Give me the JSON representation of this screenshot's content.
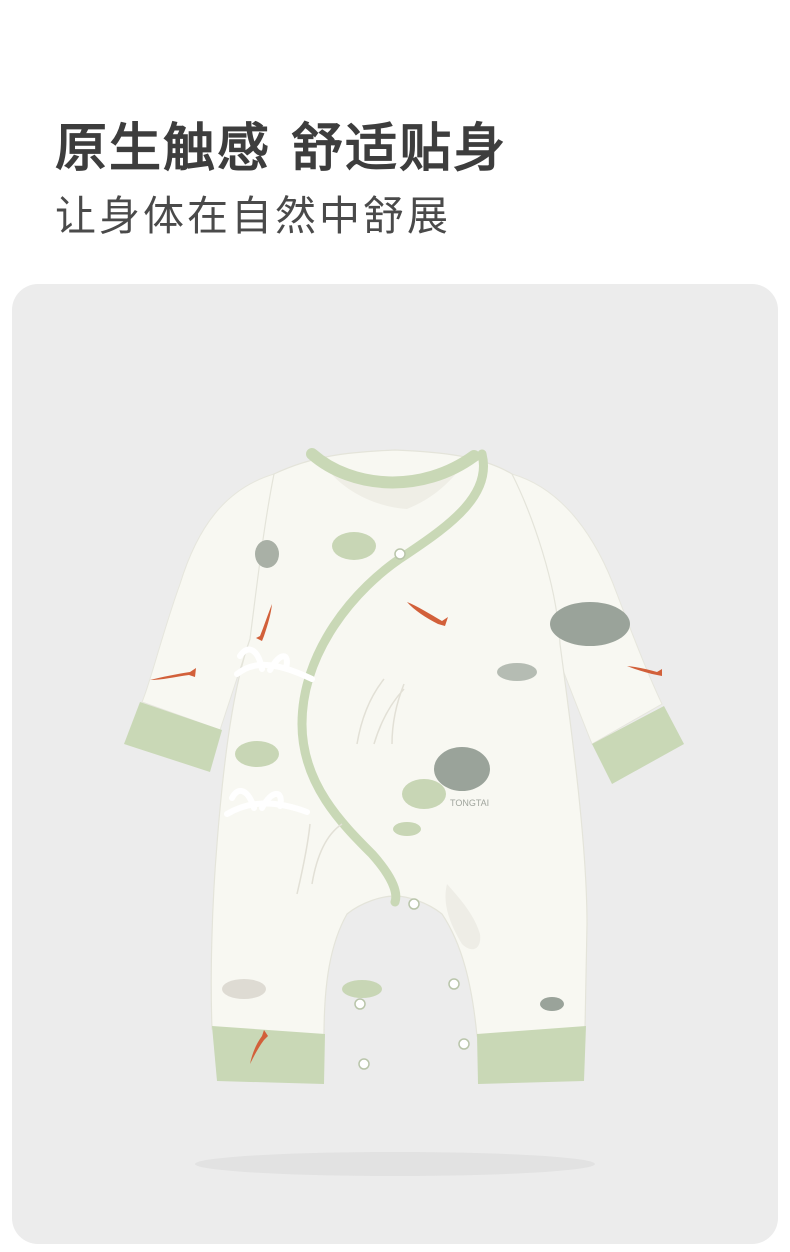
{
  "headline": "原生触感 舒适贴身",
  "subline": "让身体在自然中舒展",
  "product": {
    "name": "baby-romper",
    "print_text": "TONGTAI",
    "colors": {
      "fabric": "#f8f8f2",
      "trim": "#c9d8b6",
      "trim_dark": "#a9bd94",
      "card_bg": "#ececec",
      "koi": "#d2603a",
      "leaf": "#9aa39a",
      "leaf_green": "#c8d6b5"
    }
  }
}
